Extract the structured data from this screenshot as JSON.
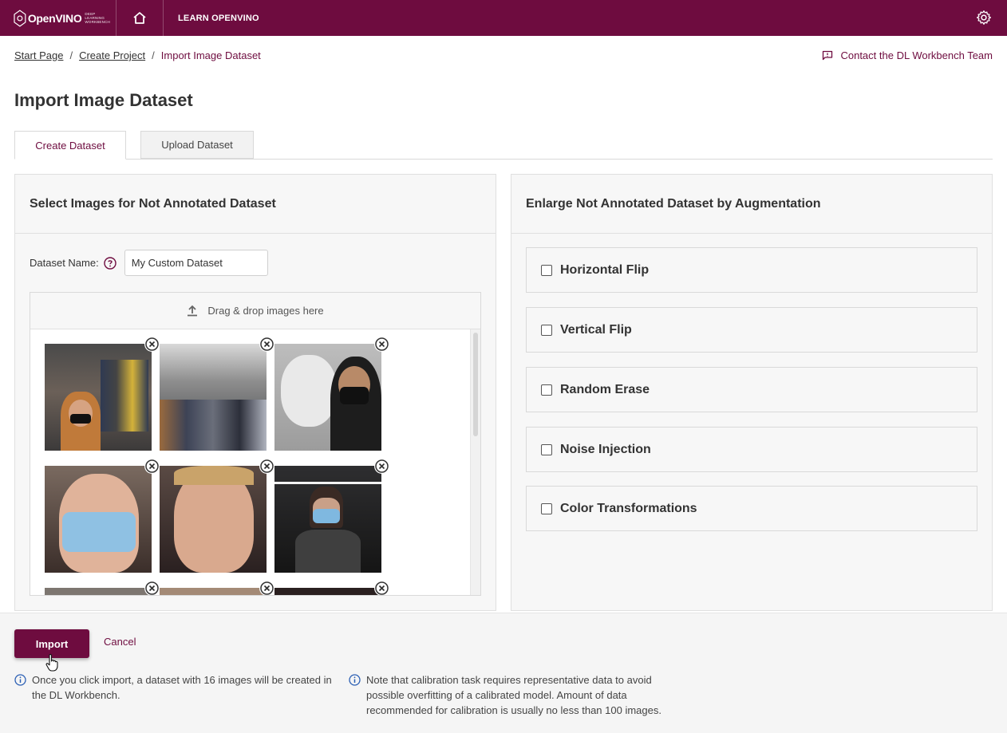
{
  "header": {
    "logo_text": "OpenVINO",
    "logo_sub_1": "DEEP LEARNING",
    "logo_sub_2": "WORKBENCH",
    "learn_label": "LEARN OPENVINO",
    "brand_color": "#6e0c3f"
  },
  "breadcrumb": {
    "items": [
      "Start Page",
      "Create Project"
    ],
    "current": "Import Image Dataset",
    "separator": "/"
  },
  "contact_label": "Contact the DL Workbench Team",
  "page_title": "Import Image Dataset",
  "tabs": [
    {
      "label": "Create Dataset",
      "active": true
    },
    {
      "label": "Upload Dataset",
      "active": false
    }
  ],
  "left_panel": {
    "title": "Select Images for Not Annotated Dataset",
    "dataset_name_label": "Dataset Name:",
    "dataset_name_value": "My Custom Dataset",
    "drop_label": "Drag & drop images here"
  },
  "right_panel": {
    "title": "Enlarge Not Annotated Dataset by Augmentation",
    "options": [
      {
        "label": "Horizontal Flip",
        "checked": false
      },
      {
        "label": "Vertical Flip",
        "checked": false
      },
      {
        "label": "Random Erase",
        "checked": false
      },
      {
        "label": "Noise Injection",
        "checked": false
      },
      {
        "label": "Color Transformations",
        "checked": false
      }
    ]
  },
  "footer": {
    "import_label": "Import",
    "cancel_label": "Cancel",
    "note_1": "Once you click import, a dataset with 16 images will be created in the DL Workbench.",
    "note_2": "Note that calibration task requires representative data to avoid possible overfitting of a calibrated model. Amount of data recommended for calibration is usually no less than 100 images."
  }
}
